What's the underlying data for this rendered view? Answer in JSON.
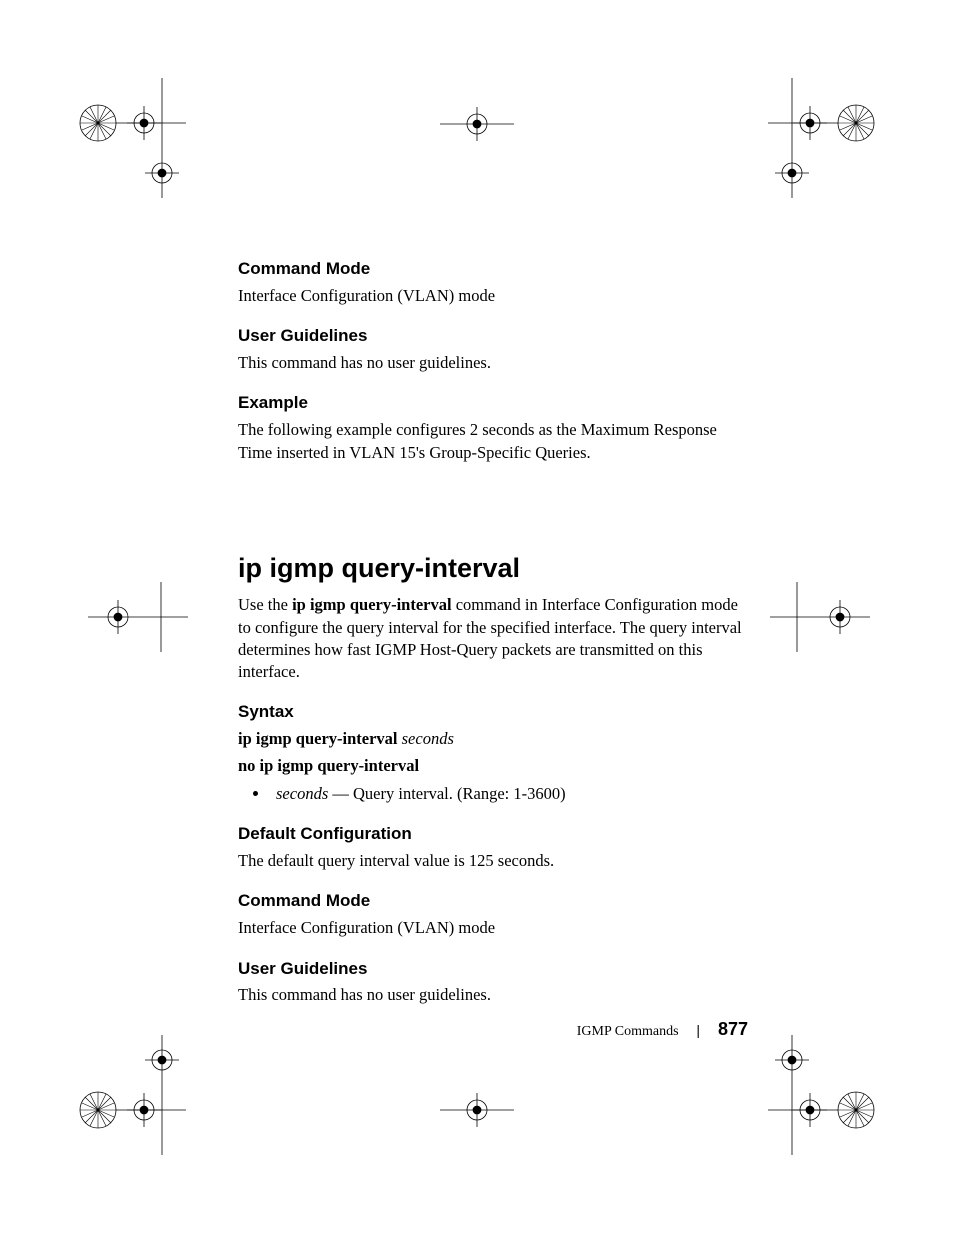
{
  "sections": {
    "cmdMode1": {
      "heading": "Command Mode",
      "body": "Interface Configuration (VLAN) mode"
    },
    "userGuide1": {
      "heading": "User Guidelines",
      "body": "This command has no user guidelines."
    },
    "example": {
      "heading": "Example",
      "body": "The following example configures 2 seconds as the Maximum Response Time inserted in VLAN 15's Group-Specific Queries."
    },
    "commandTitle": "ip igmp query-interval",
    "commandIntro_pre": "Use the ",
    "commandIntro_bold": "ip igmp query-interval",
    "commandIntro_post": " command in Interface Configuration mode to configure the query interval for the specified interface. The query interval determines how fast IGMP Host-Query packets are transmitted on this interface.",
    "syntax": {
      "heading": "Syntax",
      "line1_bold": "ip igmp query-interval ",
      "line1_ital": "seconds",
      "line2": "no ip igmp query-interval",
      "bullet_ital": "seconds",
      "bullet_rest": " — Query interval. (Range: 1-3600)"
    },
    "defaultCfg": {
      "heading": "Default Configuration",
      "body": "The default query interval value is 125 seconds."
    },
    "cmdMode2": {
      "heading": "Command Mode",
      "body": "Interface Configuration (VLAN) mode"
    },
    "userGuide2": {
      "heading": "User Guidelines",
      "body": "This command has no user guidelines."
    }
  },
  "footer": {
    "chapter": "IGMP Commands",
    "page": "877"
  }
}
